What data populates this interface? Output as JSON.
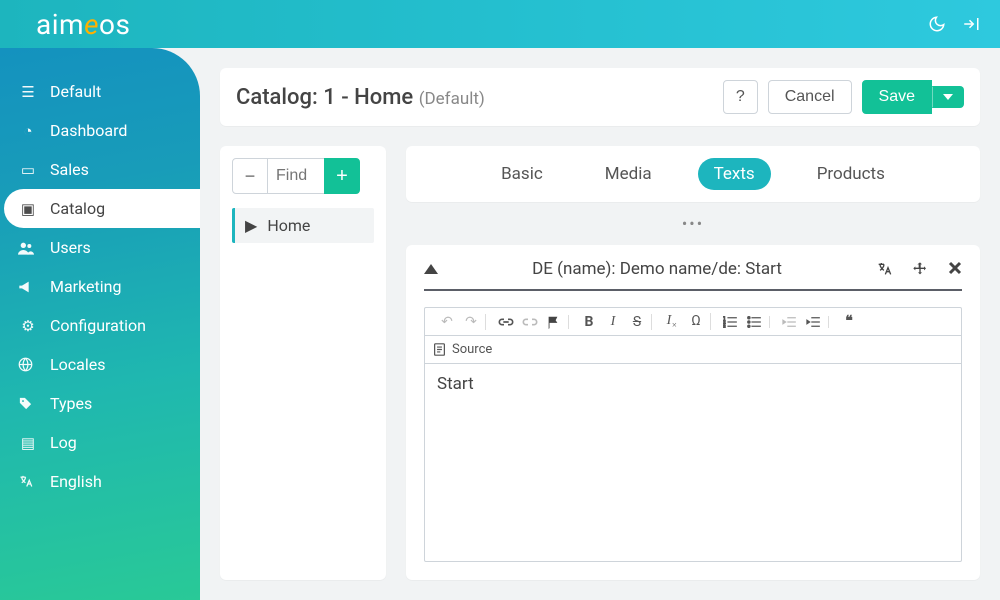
{
  "brand": {
    "name_pre": "aim",
    "name_accent": "e",
    "name_post": "os"
  },
  "sidebar": {
    "items": [
      {
        "label": "Default",
        "icon": "▤"
      },
      {
        "label": "Dashboard",
        "icon": "❍"
      },
      {
        "label": "Sales",
        "icon": "▭"
      },
      {
        "label": "Catalog",
        "icon": "▣",
        "active": true
      },
      {
        "label": "Users",
        "icon": "👥"
      },
      {
        "label": "Marketing",
        "icon": "📣"
      },
      {
        "label": "Configuration",
        "icon": "⚙"
      },
      {
        "label": "Locales",
        "icon": "🌐"
      },
      {
        "label": "Types",
        "icon": "🏷"
      },
      {
        "label": "Log",
        "icon": "📋"
      },
      {
        "label": "English",
        "icon": "⇄"
      }
    ]
  },
  "page": {
    "title_prefix": "Catalog:",
    "title_main": "1 - Home",
    "title_suffix": "(Default)",
    "help": "?",
    "cancel": "Cancel",
    "save": "Save"
  },
  "tree": {
    "find_placeholder": "Find",
    "collapse": "−",
    "add": "+",
    "items": [
      {
        "label": "Home",
        "expanded": false
      }
    ]
  },
  "tabs": [
    {
      "label": "Basic"
    },
    {
      "label": "Media"
    },
    {
      "label": "Texts",
      "active": true
    },
    {
      "label": "Products"
    }
  ],
  "editor": {
    "heading": "DE (name): Demo name/de: Start",
    "source_label": "Source",
    "content": "Start",
    "toolbar_names": [
      "undo",
      "redo",
      "link",
      "unlink",
      "anchor",
      "bold",
      "italic",
      "strike",
      "clear-format",
      "special-char",
      "ol",
      "ul",
      "outdent",
      "indent",
      "blockquote"
    ]
  }
}
